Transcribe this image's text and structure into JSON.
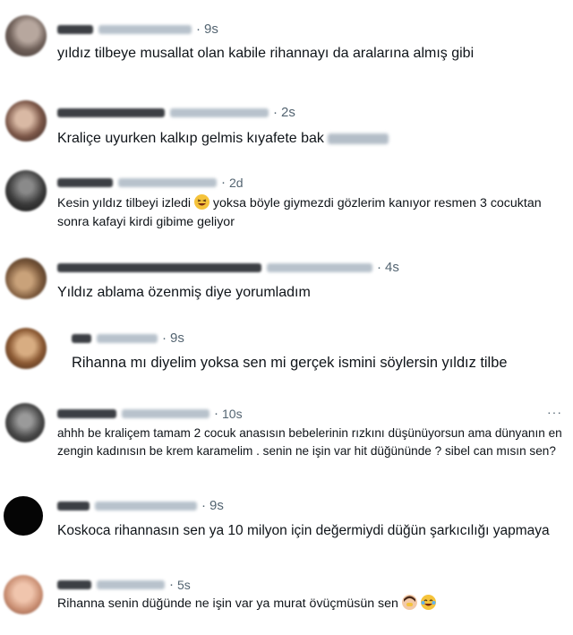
{
  "tweets": [
    {
      "time": "9s",
      "text": "yıldız tilbeye musallat olan kabile rihannayı da aralarına almış gibi"
    },
    {
      "time": "2s",
      "text": "Kraliçe uyurken kalkıp gelmis kıyafete bak"
    },
    {
      "time": "2d",
      "text_a": "Kesin yıldız tilbeyi izledi",
      "text_b": " yoksa böyle giymezdi gözlerim kanıyor resmen 3 cocuktan sonra kafayi kirdi gibime geliyor"
    },
    {
      "time": "4s",
      "text": "Yıldız ablama özenmiş diye yorumladım"
    },
    {
      "time": "9s",
      "text": "Rihanna mı diyelim yoksa sen mi gerçek ismini söylersin yıldız tilbe"
    },
    {
      "time": "10s",
      "text": "ahhh be kraliçem tamam 2 cocuk anasısın bebelerinin rızkını düşünüyorsun ama dünyanın en zengin kadınısın be krem karamelim . senin ne işin var hit düğününde ? sibel can mısın sen?",
      "more": "···"
    },
    {
      "time": "9s",
      "text": "Koskoca rihannasın sen ya 10 milyon için değermiydi düğün şarkıcılığı yapmaya"
    },
    {
      "time": "5s",
      "text": "Rihanna senin düğünde ne işin var ya murat övüçmüsün sen"
    }
  ],
  "dot": "·",
  "icons": [
    "grinning-squinting-face-icon",
    "woman-facepalming-icon",
    "face-with-tears-of-joy-icon"
  ],
  "colors": {
    "text": "#0f1419",
    "muted": "#536471",
    "background": "#ffffff"
  }
}
